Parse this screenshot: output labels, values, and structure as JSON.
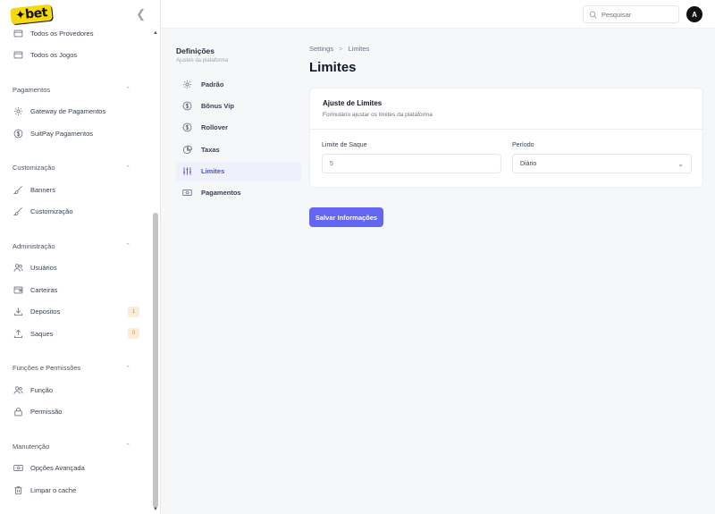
{
  "app": {
    "logo_text": "✦bet"
  },
  "topbar": {
    "search_placeholder": "Pesquisar",
    "avatar_initial": "A"
  },
  "sidebar": {
    "top_items": [
      {
        "label": "Todos os Provedores",
        "icon": "folder-icon"
      },
      {
        "label": "Todos os Jogos",
        "icon": "folder-icon"
      }
    ],
    "sections": [
      {
        "title": "Pagamentos",
        "items": [
          {
            "label": "Gateway de Pagamentos",
            "icon": "gear-icon"
          },
          {
            "label": "SuitPay Pagamentos",
            "icon": "dollar-icon"
          }
        ]
      },
      {
        "title": "Customização",
        "items": [
          {
            "label": "Banners",
            "icon": "brush-icon"
          },
          {
            "label": "Customização",
            "icon": "brush-icon"
          }
        ]
      },
      {
        "title": "Administração",
        "items": [
          {
            "label": "Usuários",
            "icon": "users-icon"
          },
          {
            "label": "Carteiras",
            "icon": "wallet-icon"
          },
          {
            "label": "Depositos",
            "icon": "download-icon",
            "badge": "1"
          },
          {
            "label": "Saques",
            "icon": "upload-icon",
            "badge": "0"
          }
        ]
      },
      {
        "title": "Funções e Permissões",
        "items": [
          {
            "label": "Função",
            "icon": "users-icon"
          },
          {
            "label": "Permissão",
            "icon": "lock-icon"
          }
        ]
      },
      {
        "title": "Manutenção",
        "items": [
          {
            "label": "Opções Avançada",
            "icon": "cash-icon"
          },
          {
            "label": "Limpar o cache",
            "icon": "trash-icon"
          }
        ]
      }
    ]
  },
  "submenu": {
    "title": "Definições",
    "description": "Ajustes da plataforma",
    "items": [
      {
        "label": "Padrão",
        "icon": "gear-icon"
      },
      {
        "label": "Bônus Vip",
        "icon": "dollar-icon"
      },
      {
        "label": "Rollover",
        "icon": "dollar-icon"
      },
      {
        "label": "Taxas",
        "icon": "pie-icon"
      },
      {
        "label": "Limites",
        "icon": "sliders-icon",
        "active": true
      },
      {
        "label": "Pagamentos",
        "icon": "cash-icon"
      }
    ]
  },
  "main": {
    "breadcrumb": {
      "root": "Settings",
      "separator": ">",
      "current": "Limites"
    },
    "title": "Limites",
    "card": {
      "title": "Ajuste de Limites",
      "description": "Formulário ajustar os limites da plataforma",
      "fields": {
        "limit": {
          "label": "Limite de Saque",
          "value": "5"
        },
        "period": {
          "label": "Período",
          "value": "Diário"
        }
      }
    },
    "save_label": "Salvar Informações"
  },
  "colors": {
    "accent": "#6366f1",
    "active_bg": "#eef1fb",
    "badge_bg": "#fdecd9",
    "badge_text": "#e08540"
  }
}
